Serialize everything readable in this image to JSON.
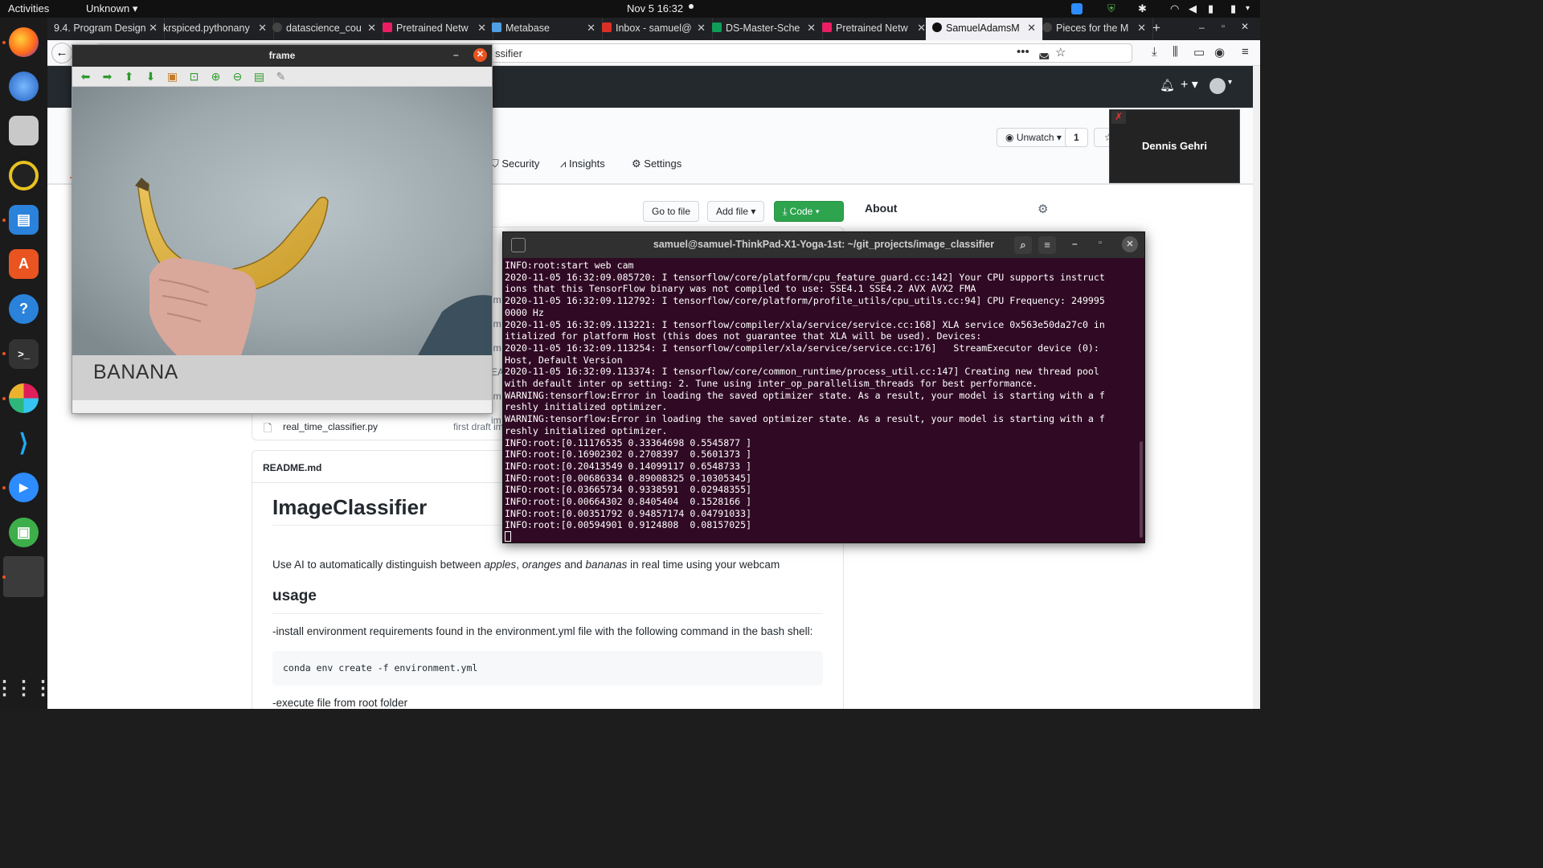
{
  "topbar": {
    "activities": "Activities",
    "app_menu": "Unknown",
    "clock": "Nov 5  16:32"
  },
  "tabs": [
    {
      "label": "9.4. Program Design"
    },
    {
      "label": "krspiced.pythonany"
    },
    {
      "label": "datascience_cou"
    },
    {
      "label": "Pretrained Netw"
    },
    {
      "label": "Metabase"
    },
    {
      "label": "Inbox - samuel@"
    },
    {
      "label": "DS-Master-Sche"
    },
    {
      "label": "Pretrained Netw"
    },
    {
      "label": "SamuelAdamsM"
    },
    {
      "label": "Pieces for the M"
    }
  ],
  "urlbar": {
    "text": "ssifier"
  },
  "repo": {
    "unwatch_label": "Unwatch",
    "watch_count": "1",
    "nav": {
      "security": "Security",
      "insights": "Insights",
      "settings": "Settings"
    },
    "go_to_file": "Go to file",
    "add_file": "Add file",
    "code": "Code",
    "about": "About",
    "file_row": {
      "name": "real_time_classifier.py",
      "message": "first draft im"
    },
    "side_truncated": [
      "im",
      "im",
      "im",
      "im",
      "im",
      "EA",
      "im",
      "im"
    ]
  },
  "readme": {
    "filename": "README.md",
    "title": "ImageClassifier",
    "intro_pre": "Use AI to automatically distinguish between ",
    "intro_apples": "apples",
    "intro_oranges": "oranges",
    "intro_and": " and ",
    "intro_bananas": "bananas",
    "intro_post": " in real time using your webcam",
    "usage_heading": "usage",
    "install_text": "-install environment requirements found in the environment.yml file with the following command in the bash shell:",
    "install_cmd": "conda env create -f environment.yml",
    "execute_text": "-execute file from root folder"
  },
  "frame_window": {
    "title": "frame",
    "prediction": "BANANA"
  },
  "terminal": {
    "title": "samuel@samuel-ThinkPad-X1-Yoga-1st: ~/git_projects/image_classifier",
    "lines": [
      "INFO:root:start web cam",
      "2020-11-05 16:32:09.085720: I tensorflow/core/platform/cpu_feature_guard.cc:142] Your CPU supports instruct",
      "ions that this TensorFlow binary was not compiled to use: SSE4.1 SSE4.2 AVX AVX2 FMA",
      "2020-11-05 16:32:09.112792: I tensorflow/core/platform/profile_utils/cpu_utils.cc:94] CPU Frequency: 249995",
      "0000 Hz",
      "2020-11-05 16:32:09.113221: I tensorflow/compiler/xla/service/service.cc:168] XLA service 0x563e50da27c0 in",
      "itialized for platform Host (this does not guarantee that XLA will be used). Devices:",
      "2020-11-05 16:32:09.113254: I tensorflow/compiler/xla/service/service.cc:176]   StreamExecutor device (0):",
      "Host, Default Version",
      "2020-11-05 16:32:09.113374: I tensorflow/core/common_runtime/process_util.cc:147] Creating new thread pool",
      "with default inter op setting: 2. Tune using inter_op_parallelism_threads for best performance.",
      "WARNING:tensorflow:Error in loading the saved optimizer state. As a result, your model is starting with a f",
      "reshly initialized optimizer.",
      "WARNING:tensorflow:Error in loading the saved optimizer state. As a result, your model is starting with a f",
      "reshly initialized optimizer.",
      "INFO:root:[0.11176535 0.33364698 0.5545877 ]",
      "INFO:root:[0.16902302 0.2708397  0.5601373 ]",
      "INFO:root:[0.20413549 0.14099117 0.6548733 ]",
      "INFO:root:[0.00686334 0.89008325 0.10305345]",
      "INFO:root:[0.03665734 0.9338591  0.02948355]",
      "INFO:root:[0.00664302 0.8405404  0.1528166 ]",
      "INFO:root:[0.00351792 0.94857174 0.04791033]",
      "INFO:root:[0.00594901 0.9124808  0.08157025]"
    ]
  },
  "video_call": {
    "participant": "Dennis Gehri"
  },
  "colors": {
    "terminal_bg": "#300a24",
    "github_green": "#2ea44f",
    "ubuntu_orange": "#e95420"
  }
}
